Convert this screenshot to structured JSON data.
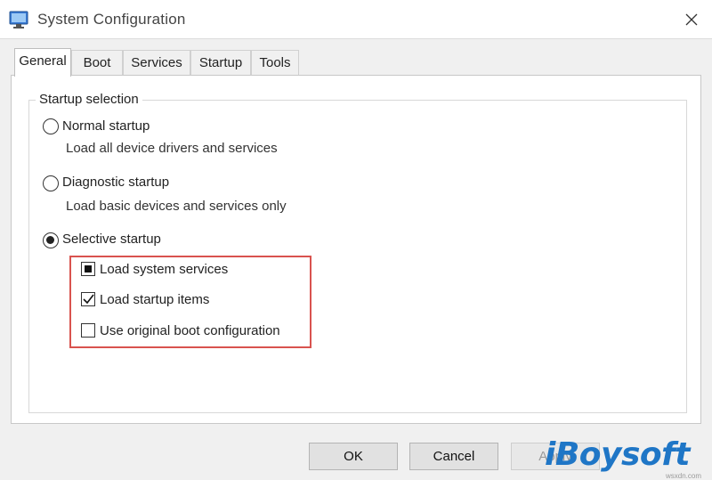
{
  "window": {
    "title": "System Configuration",
    "icon": "msconfig-icon",
    "close_icon": "close-icon"
  },
  "tabs": [
    {
      "label": "General",
      "active": true
    },
    {
      "label": "Boot",
      "active": false
    },
    {
      "label": "Services",
      "active": false
    },
    {
      "label": "Startup",
      "active": false
    },
    {
      "label": "Tools",
      "active": false
    }
  ],
  "startup_selection": {
    "legend": "Startup selection",
    "options": [
      {
        "label": "Normal startup",
        "description": "Load all device drivers and services",
        "selected": false
      },
      {
        "label": "Diagnostic startup",
        "description": "Load basic devices and services only",
        "selected": false
      },
      {
        "label": "Selective startup",
        "selected": true
      }
    ],
    "selective_items": [
      {
        "label": "Load system services",
        "state": "indeterminate"
      },
      {
        "label": "Load startup items",
        "state": "checked"
      },
      {
        "label": "Use original boot configuration",
        "state": "unchecked"
      }
    ],
    "highlight_color": "#d9534f"
  },
  "buttons": {
    "ok": "OK",
    "cancel": "Cancel",
    "apply": "Apply"
  },
  "watermark": {
    "brand": "iBoysoft",
    "site": "wsxdn.com",
    "color": "#1f76c6"
  }
}
